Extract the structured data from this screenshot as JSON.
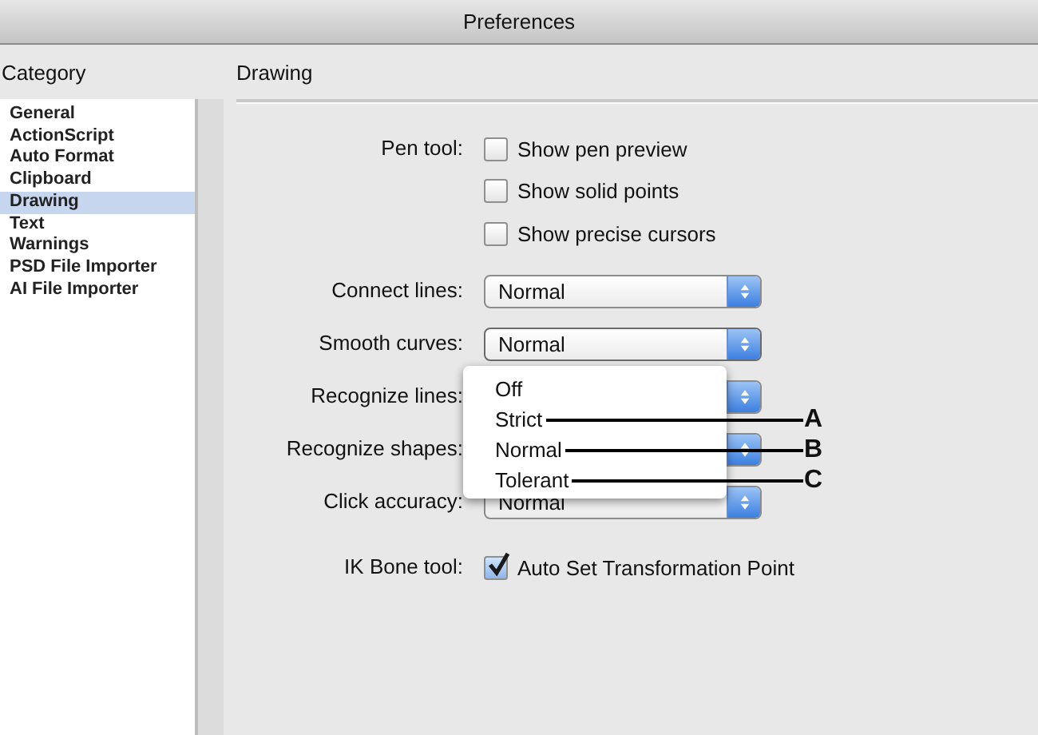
{
  "window": {
    "title": "Preferences"
  },
  "sidebar": {
    "heading": "Category",
    "items": [
      {
        "label": "General",
        "selected": false
      },
      {
        "label": "ActionScript",
        "selected": false
      },
      {
        "label": "Auto Format",
        "selected": false
      },
      {
        "label": "Clipboard",
        "selected": false
      },
      {
        "label": "Drawing",
        "selected": true
      },
      {
        "label": "Text",
        "selected": false
      },
      {
        "label": "Warnings",
        "selected": false
      },
      {
        "label": "PSD File Importer",
        "selected": false
      },
      {
        "label": "AI File Importer",
        "selected": false
      }
    ]
  },
  "panel": {
    "heading": "Drawing",
    "settings": [
      {
        "kind": "checkboxes",
        "label": "Pen tool:",
        "options": [
          {
            "label": "Show pen preview",
            "checked": false
          },
          {
            "label": "Show solid points",
            "checked": false
          },
          {
            "label": "Show precise cursors",
            "checked": false
          }
        ]
      },
      {
        "kind": "select",
        "label": "Connect lines:",
        "value": "Normal"
      },
      {
        "kind": "select",
        "label": "Smooth curves:",
        "value": "Normal",
        "menu_open": true
      },
      {
        "kind": "select",
        "label": "Recognize lines:"
      },
      {
        "kind": "select",
        "label": "Recognize shapes:"
      },
      {
        "kind": "select",
        "label": "Click accuracy:",
        "value": "Normal"
      },
      {
        "kind": "checkboxes",
        "label": "IK Bone tool:",
        "options": [
          {
            "label": "Auto Set Transformation Point",
            "checked": true
          }
        ]
      }
    ]
  },
  "popup_menu": {
    "items": [
      {
        "label": "Off"
      },
      {
        "label": "Strict",
        "callout": "A"
      },
      {
        "label": "Normal",
        "callout": "B"
      },
      {
        "label": "Tolerant",
        "callout": "C"
      }
    ]
  }
}
